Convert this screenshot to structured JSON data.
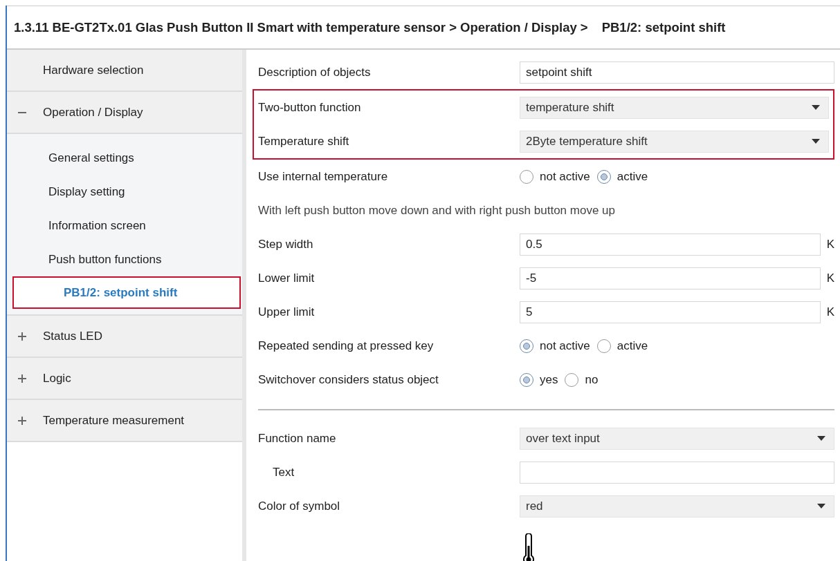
{
  "breadcrumb": [
    "1.3.11 BE-GT2Tx.01 Glas Push Button II Smart with temperature sensor > Operation / Display >",
    "PB1/2: setpoint shift"
  ],
  "sidebar": {
    "items": [
      {
        "label": "Hardware selection",
        "kind": "page",
        "selected": false
      },
      {
        "label": "Operation / Display",
        "kind": "group",
        "expanded": true,
        "selected": false,
        "children": [
          {
            "label": "General settings",
            "selected": false
          },
          {
            "label": "Display setting",
            "selected": false
          },
          {
            "label": "Information screen",
            "selected": false
          },
          {
            "label": "Push button functions",
            "selected": false
          },
          {
            "label": "PB1/2: setpoint shift",
            "selected": true
          }
        ]
      },
      {
        "label": "Status LED",
        "kind": "group",
        "expanded": false,
        "selected": false
      },
      {
        "label": "Logic",
        "kind": "group",
        "expanded": false,
        "selected": false
      },
      {
        "label": "Temperature measurement",
        "kind": "group",
        "expanded": false,
        "selected": false
      }
    ]
  },
  "sections": [
    {
      "highlighted": false,
      "rows": [
        {
          "kind": "text",
          "label": "Description of objects",
          "value": "setpoint shift"
        }
      ]
    },
    {
      "highlighted": true,
      "rows": [
        {
          "kind": "select",
          "label": "Two-button function",
          "value": "temperature shift"
        },
        {
          "kind": "select",
          "label": "Temperature shift",
          "value": "2Byte temperature shift"
        }
      ]
    },
    {
      "highlighted": false,
      "rows": [
        {
          "kind": "radio",
          "label": "Use internal temperature",
          "options": [
            {
              "label": "not active",
              "selected": false
            },
            {
              "label": "active",
              "selected": true
            }
          ]
        },
        {
          "kind": "note",
          "label": "With left push button move down and with right push button move up"
        },
        {
          "kind": "text",
          "label": "Step width",
          "value": "0.5",
          "unit": "K"
        },
        {
          "kind": "text",
          "label": "Lower limit",
          "value": "-5",
          "unit": "K"
        },
        {
          "kind": "text",
          "label": "Upper limit",
          "value": "5",
          "unit": "K"
        },
        {
          "kind": "radio",
          "label": "Repeated sending at pressed key",
          "options": [
            {
              "label": "not active",
              "selected": true
            },
            {
              "label": "active",
              "selected": false
            }
          ]
        },
        {
          "kind": "radio",
          "label": "Switchover considers status object",
          "options": [
            {
              "label": "yes",
              "selected": true
            },
            {
              "label": "no",
              "selected": false
            }
          ]
        },
        {
          "kind": "separator"
        },
        {
          "kind": "select",
          "label": "Function name",
          "value": "over text input"
        },
        {
          "kind": "text",
          "label": "Text",
          "indent": true
        },
        {
          "kind": "select",
          "label": "Color of symbol",
          "value": "red"
        },
        {
          "kind": "symbol"
        }
      ]
    }
  ]
}
